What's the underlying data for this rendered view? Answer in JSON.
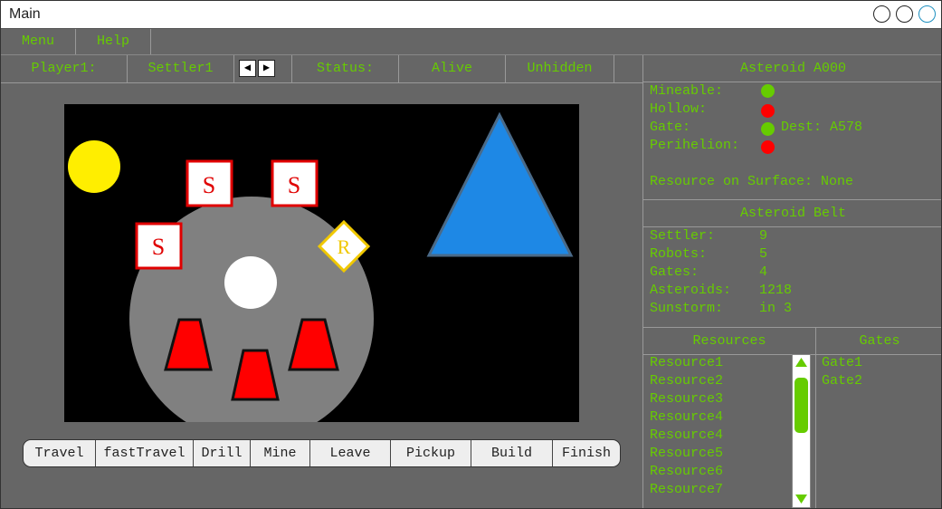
{
  "window": {
    "title": "Main"
  },
  "menu": {
    "items": [
      "Menu",
      "Help"
    ]
  },
  "status_bar": {
    "player": "Player1:",
    "settler": "Settler1",
    "prev_glyph": "◀",
    "next_glyph": "▶",
    "status_label": "Status:",
    "status_value": "Alive",
    "visibility": "Unhidden"
  },
  "game": {
    "settler_label": "S",
    "robot_label": "R"
  },
  "actions": [
    "Travel",
    "fastTravel",
    "Drill",
    "Mine",
    "Leave",
    "Pickup",
    "Build",
    "Finish"
  ],
  "asteroid": {
    "title": "Asteroid A000",
    "mineable_label": "Mineable:",
    "mineable_status": "green",
    "hollow_label": "Hollow:",
    "hollow_status": "red",
    "gate_label": "Gate:",
    "gate_status": "green",
    "gate_dest": "Dest: A578",
    "perihelion_label": "Perihelion:",
    "perihelion_status": "red",
    "resource_label": "Resource on Surface:",
    "resource_value": "None"
  },
  "belt": {
    "title": "Asteroid Belt",
    "settler_label": "Settler:",
    "settler_value": "9",
    "robots_label": "Robots:",
    "robots_value": "5",
    "gates_label": "Gates:",
    "gates_value": "4",
    "asteroids_label": "Asteroids:",
    "asteroids_value": "1218",
    "sunstorm_label": "Sunstorm:",
    "sunstorm_value": "in 3"
  },
  "resources": {
    "title": "Resources",
    "items": [
      "Resource1",
      "Resource2",
      "Resource3",
      "Resource4",
      "Resource4",
      "Resource5",
      "Resource6",
      "Resource7"
    ]
  },
  "gates": {
    "title": "Gates",
    "items": [
      "Gate1",
      "Gate2"
    ]
  },
  "colors": {
    "text_green": "#66cc00",
    "panel_gray": "#666666",
    "status_green": "#66cc00",
    "status_red": "#ff0000",
    "sun": "#ffee00",
    "asteroid": "#808080",
    "gate_triangle": "#1e88e5"
  }
}
